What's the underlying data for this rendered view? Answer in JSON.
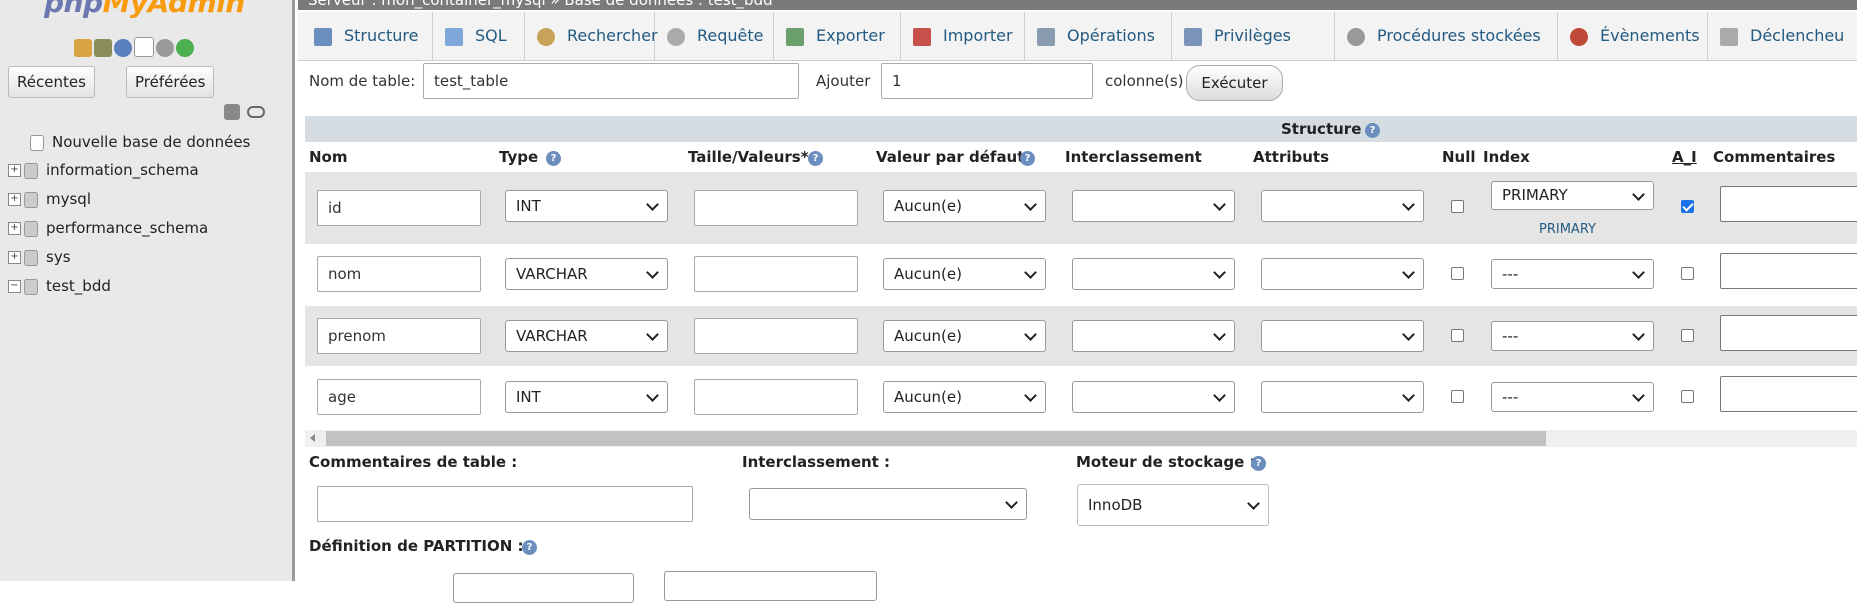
{
  "app": {
    "logo_main": "php",
    "logo_accent": "MyAdmin"
  },
  "breadcrumb": "Serveur : mon_container_mysql » Base de données : test_bdd",
  "sidebar": {
    "tabs": [
      "Récentes",
      "Préférées"
    ],
    "tree": [
      {
        "label": "Nouvelle base de données",
        "expander": ""
      },
      {
        "label": "information_schema",
        "expander": "+"
      },
      {
        "label": "mysql",
        "expander": "+"
      },
      {
        "label": "performance_schema",
        "expander": "+"
      },
      {
        "label": "sys",
        "expander": "+"
      },
      {
        "label": "test_bdd",
        "expander": "−"
      }
    ]
  },
  "tabs": [
    {
      "label": "Structure",
      "icon": "structure-icon"
    },
    {
      "label": "SQL",
      "icon": "sql-icon"
    },
    {
      "label": "Rechercher",
      "icon": "search-icon"
    },
    {
      "label": "Requête",
      "icon": "query-icon"
    },
    {
      "label": "Exporter",
      "icon": "export-icon"
    },
    {
      "label": "Importer",
      "icon": "import-icon"
    },
    {
      "label": "Opérations",
      "icon": "wrench-icon"
    },
    {
      "label": "Privilèges",
      "icon": "privileges-icon"
    },
    {
      "label": "Procédures stockées",
      "icon": "routines-icon"
    },
    {
      "label": "Évènements",
      "icon": "clock-icon"
    },
    {
      "label": "Déclencheu",
      "icon": "triggers-icon"
    }
  ],
  "form": {
    "table_name_label": "Nom de table:",
    "table_name_value": "test_table",
    "add_label": "Ajouter",
    "add_value": "1",
    "columns_label": "colonne(s)",
    "execute_label": "Exécuter"
  },
  "structure": {
    "title": "Structure",
    "headers": {
      "nom": "Nom",
      "type": "Type",
      "taille": "Taille/Valeurs*",
      "defaut": "Valeur par défaut",
      "interclassement": "Interclassement",
      "attributs": "Attributs",
      "null": "Null",
      "index": "Index",
      "ai": "A_I",
      "commentaires": "Commentaires"
    },
    "rows": [
      {
        "name": "id",
        "type": "INT",
        "size": "",
        "default": "Aucun(e)",
        "null": false,
        "index": "PRIMARY",
        "index_note": "PRIMARY",
        "ai": true
      },
      {
        "name": "nom",
        "type": "VARCHAR",
        "size": "",
        "default": "Aucun(e)",
        "null": false,
        "index": "---",
        "index_note": "",
        "ai": false
      },
      {
        "name": "prenom",
        "type": "VARCHAR",
        "size": "",
        "default": "Aucun(e)",
        "null": false,
        "index": "---",
        "index_note": "",
        "ai": false
      },
      {
        "name": "age",
        "type": "INT",
        "size": "",
        "default": "Aucun(e)",
        "null": false,
        "index": "---",
        "index_note": "",
        "ai": false
      }
    ]
  },
  "table_options": {
    "comments_label": "Commentaires de table :",
    "collation_label": "Interclassement :",
    "engine_label": "Moteur de stockage :",
    "engine_value": "InnoDB",
    "partition_label": "Définition de PARTITION :"
  },
  "colors": {
    "accent": "#235a81",
    "sidebar_bg": "#e9e9e9",
    "row_alt": "#e5e5e5",
    "header_bg": "#d5dde3"
  }
}
